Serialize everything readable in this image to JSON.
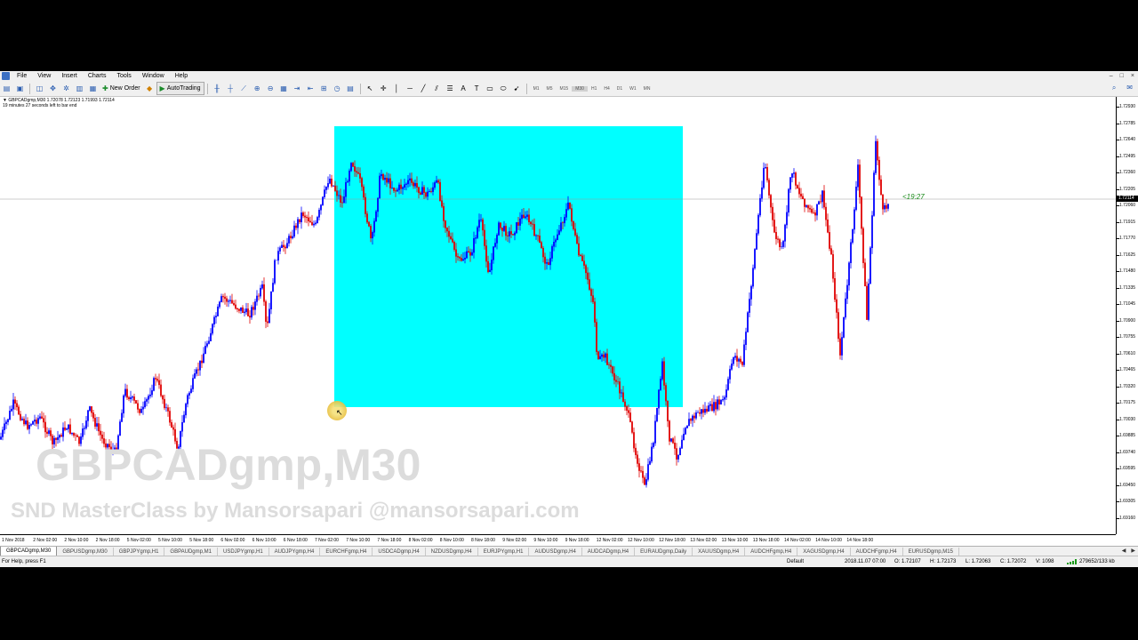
{
  "menu": {
    "items": [
      "File",
      "View",
      "Insert",
      "Charts",
      "Tools",
      "Window",
      "Help"
    ],
    "window_controls": [
      "–",
      "□",
      "×"
    ]
  },
  "toolbar": {
    "new_order_label": "New Order",
    "autotrading_label": "AutoTrading",
    "timeframes": [
      "M1",
      "M5",
      "M15",
      "M30",
      "H1",
      "H4",
      "D1",
      "W1",
      "MN"
    ],
    "active_timeframe": "M30"
  },
  "chart": {
    "info_line1": "▼ GBPCADgmp,M30  1.72078 1.72123 1.71993 1.72114",
    "info_line2": "19 minutes 27 seconds left to bar end",
    "watermark_title": "GBPCADgmp,M30",
    "watermark_subtitle": "SND MasterClass by Mansorsapari @mansorsapari.com",
    "countdown": "<19:27",
    "current_price": "1.72114",
    "colors": {
      "bull": "#0000ff",
      "bear": "#e00000",
      "zone": "#00ffff"
    },
    "price_labels": [
      "1.72930",
      "1.72785",
      "1.72640",
      "1.72495",
      "1.72360",
      "1.72205",
      "1.72060",
      "1.71915",
      "1.71770",
      "1.71625",
      "1.71480",
      "1.71335",
      "1.71045",
      "1.70900",
      "1.70755",
      "1.70610",
      "1.70465",
      "1.70320",
      "1.70175",
      "1.70030",
      "1.69885",
      "1.69740",
      "1.69595",
      "1.69450",
      "1.69305",
      "1.69160"
    ],
    "time_labels": [
      "1 Nov 2018",
      "2 Nov 02:00",
      "2 Nov 10:00",
      "2 Nov 18:00",
      "5 Nov 02:00",
      "5 Nov 10:00",
      "5 Nov 18:00",
      "6 Nov 02:00",
      "6 Nov 10:00",
      "6 Nov 18:00",
      "7 Nov 02:00",
      "7 Nov 10:00",
      "7 Nov 18:00",
      "8 Nov 02:00",
      "8 Nov 10:00",
      "8 Nov 18:00",
      "9 Nov 02:00",
      "9 Nov 10:00",
      "9 Nov 18:00",
      "12 Nov 02:00",
      "12 Nov 10:00",
      "12 Nov 18:00",
      "13 Nov 02:00",
      "13 Nov 10:00",
      "13 Nov 18:00",
      "14 Nov 02:00",
      "14 Nov 10:00",
      "14 Nov 18:00"
    ]
  },
  "tabs": {
    "items": [
      "GBPCADgmp,M30",
      "GBPUSDgmp,M30",
      "GBPJPYgmp,H1",
      "GBPAUDgmp,M1",
      "USDJPYgmp,H1",
      "AUDJPYgmp,H4",
      "EURCHFgmp,H4",
      "USDCADgmp,H4",
      "NZDUSDgmp,H4",
      "EURJPYgmp,H1",
      "AUDUSDgmp,H4",
      "AUDCADgmp,H4",
      "EURAUDgmp,Daily",
      "XAUUSDgmp,H4",
      "AUDCHFgmp,H4",
      "XAGUSDgmp,H4",
      "AUDCHFgmp,H4",
      "EURUSDgmp,M15"
    ],
    "active": "GBPCADgmp,M30"
  },
  "status": {
    "help_text": "For Help, press F1",
    "profile": "Default",
    "datetime": "2018.11.07 07:00",
    "open": "O: 1.72107",
    "high": "H: 1.72173",
    "low": "L: 1.72063",
    "close": "C: 1.72072",
    "volume": "V: 1098",
    "traffic": "279652/133 kb"
  }
}
